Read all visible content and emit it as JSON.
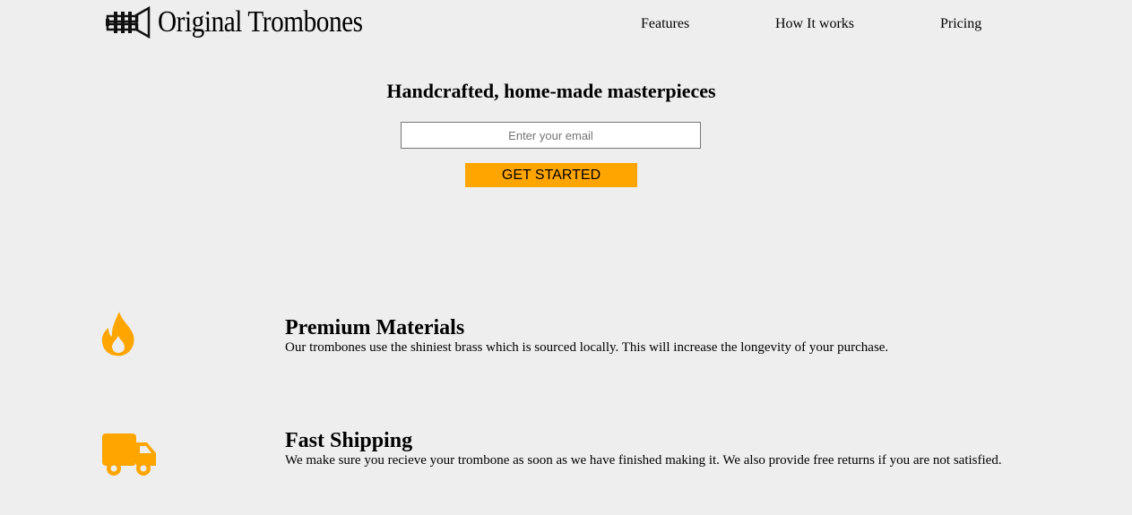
{
  "brand": {
    "name": "Original Trombones",
    "logo_icon": "trombone-icon",
    "accent_color": "#ffa500",
    "background_color": "#eeeeee"
  },
  "nav": {
    "items": [
      {
        "label": "Features"
      },
      {
        "label": "How It works"
      },
      {
        "label": "Pricing"
      }
    ]
  },
  "hero": {
    "title": "Handcrafted, home-made masterpieces",
    "email_placeholder": "Enter your email",
    "email_value": "",
    "cta_label": "GET STARTED"
  },
  "features": [
    {
      "icon": "fire-icon",
      "title": "Premium Materials",
      "description": "Our trombones use the shiniest brass which is sourced locally. This will increase the longevity of your purchase."
    },
    {
      "icon": "truck-icon",
      "title": "Fast Shipping",
      "description": "We make sure you recieve your trombone as soon as we have finished making it. We also provide free returns if you are not satisfied."
    }
  ]
}
